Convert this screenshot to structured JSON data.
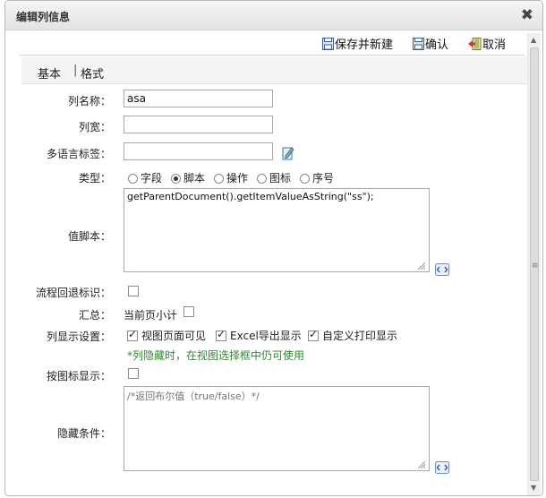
{
  "dialog": {
    "title": "编辑列信息",
    "close_glyph": "✖"
  },
  "toolbar": {
    "save_new": "保存并新建",
    "confirm": "确认",
    "cancel": "取消"
  },
  "tabs": [
    {
      "label": "基本"
    },
    {
      "label": "格式"
    }
  ],
  "tab_separator": "|",
  "form": {
    "column_name": {
      "label": "列名称：",
      "value": "asa"
    },
    "column_width": {
      "label": "列宽：",
      "value": ""
    },
    "i18n_label": {
      "label": "多语言标签：",
      "value": ""
    },
    "type": {
      "label": "类型：",
      "options": [
        "字段",
        "脚本",
        "操作",
        "图标",
        "序号"
      ],
      "selected": "脚本"
    },
    "value_script": {
      "label": "值脚本：",
      "value": "getParentDocument().getItemValueAsString(\"ss\");"
    },
    "flow_back_flag": {
      "label": "流程回退标识：",
      "checked": false
    },
    "summary": {
      "label": "汇总：",
      "option": "当前页小计",
      "checked": false
    },
    "column_display": {
      "label": "列显示设置：",
      "options": [
        {
          "label": "视图页面可见",
          "checked": true
        },
        {
          "label": "Excel导出显示",
          "checked": true
        },
        {
          "label": "自定义打印显示",
          "checked": true
        }
      ],
      "hint": "*列隐藏时，在视图选择框中仍可使用"
    },
    "icon_display": {
      "label": "按图标显示：",
      "checked": false
    },
    "hide_condition": {
      "label": "隐藏条件：",
      "placeholder": "/*返回布尔值（true/false）*/"
    }
  },
  "colors": {
    "hint": "#2e8b2e",
    "title_bg": "#e8e8e8"
  }
}
